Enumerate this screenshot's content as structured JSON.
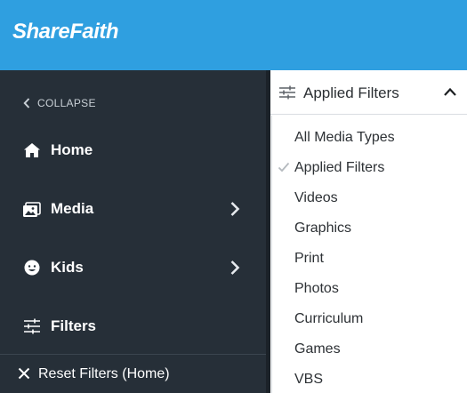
{
  "brand": {
    "logo_text": "ShareFaith",
    "header_color": "#2f9fe0"
  },
  "sidebar": {
    "collapse_label": "COLLAPSE",
    "items": [
      {
        "label": "Home",
        "icon": "home-icon",
        "has_submenu": false
      },
      {
        "label": "Media",
        "icon": "media-icon",
        "has_submenu": true
      },
      {
        "label": "Kids",
        "icon": "kids-icon",
        "has_submenu": true
      },
      {
        "label": "Filters",
        "icon": "filters-icon",
        "has_submenu": false
      }
    ],
    "reset_label": "Reset Filters (Home)",
    "background": "#262f38"
  },
  "filter_panel": {
    "header_label": "Applied Filters",
    "expanded": true,
    "options": [
      {
        "label": "All Media Types",
        "checked": false
      },
      {
        "label": "Applied Filters",
        "checked": true
      },
      {
        "label": "Videos",
        "checked": false
      },
      {
        "label": "Graphics",
        "checked": false
      },
      {
        "label": "Print",
        "checked": false
      },
      {
        "label": "Photos",
        "checked": false
      },
      {
        "label": "Curriculum",
        "checked": false
      },
      {
        "label": "Games",
        "checked": false
      },
      {
        "label": "VBS",
        "checked": false
      }
    ]
  }
}
